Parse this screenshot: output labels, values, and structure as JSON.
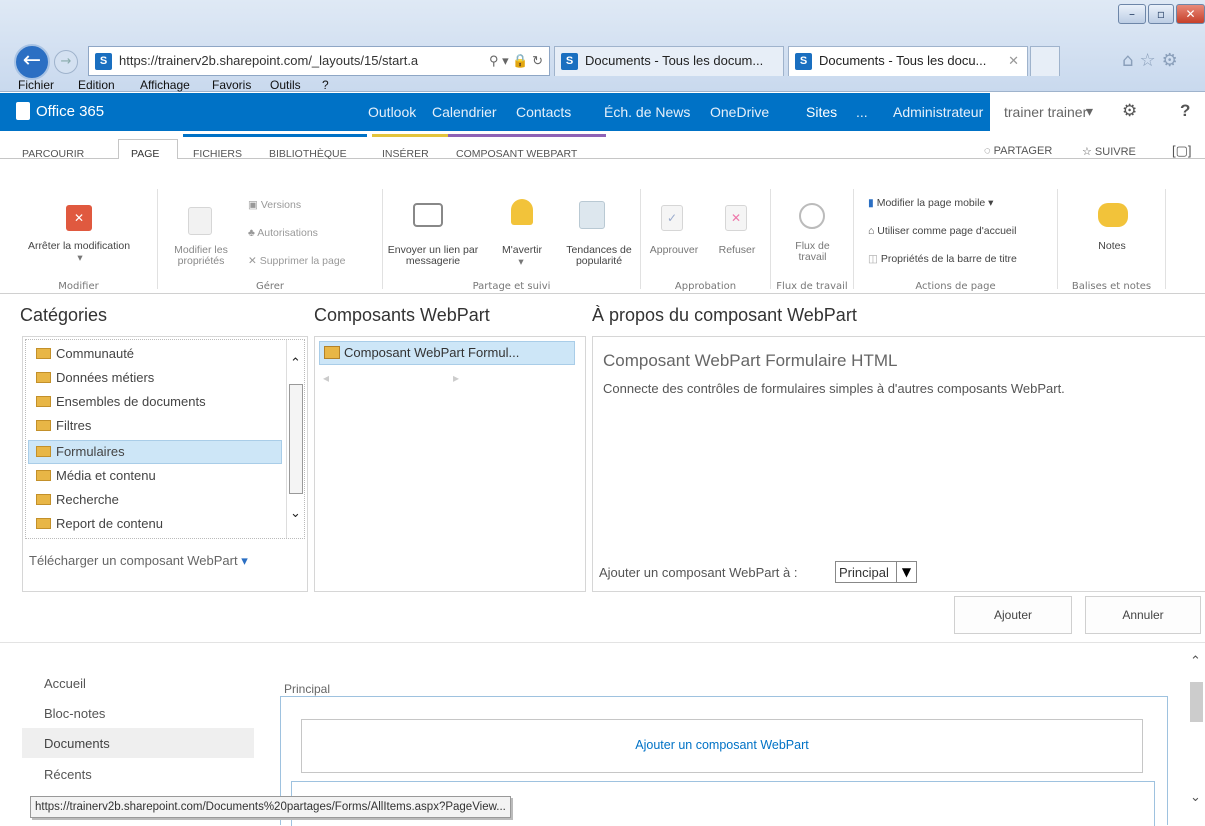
{
  "browser": {
    "window_buttons": {
      "minimize": "–",
      "maximize": "▫",
      "close": "✕"
    },
    "address": "https://trainerv2b.sharepoint.com/_layouts/15/start.a",
    "tabs": [
      "Documents - Tous les docum...",
      "Documents - Tous les docu..."
    ],
    "menu": [
      "Fichier",
      "Edition",
      "Affichage",
      "Favoris",
      "Outils",
      "?"
    ],
    "status_url": "https://trainerv2b.sharepoint.com/Documents%20partages/Forms/AllItems.aspx?PageView..."
  },
  "o365": {
    "logo": "Office 365",
    "nav": [
      "Outlook",
      "Calendrier",
      "Contacts",
      "Éch. de News",
      "OneDrive",
      "Sites",
      "...",
      "Administrateur"
    ],
    "user": "trainer trainer",
    "accent": "#0072c6"
  },
  "ribbon": {
    "tabs": [
      "PARCOURIR",
      "PAGE",
      "FICHIERS",
      "BIBLIOTHÈQUE",
      "INSÉRER",
      "COMPOSANT WEBPART"
    ],
    "share": "PARTAGER",
    "follow": "SUIVRE",
    "groups": {
      "modifier": {
        "label": "Modifier",
        "stop": "Arrêter la modification"
      },
      "gerer": {
        "label": "Gérer",
        "props": [
          "Modifier les",
          "propriétés"
        ],
        "versions": "Versions",
        "auth": "Autorisations",
        "delete": "Supprimer la page"
      },
      "partage": {
        "label": "Partage et suivi",
        "email": [
          "Envoyer un lien par",
          "messagerie"
        ],
        "alert": "M'avertir",
        "trends": [
          "Tendances de",
          "popularité"
        ]
      },
      "approbation": {
        "label": "Approbation",
        "approve": "Approuver",
        "reject": "Refuser"
      },
      "flux": {
        "label": "Flux de travail",
        "wf": [
          "Flux de",
          "travail"
        ]
      },
      "actions": {
        "label": "Actions de page",
        "mobile": "Modifier la page mobile",
        "home": "Utiliser comme page d'accueil",
        "titlebar": "Propriétés de la barre de titre"
      },
      "balises": {
        "label": "Balises et notes",
        "notes": "Notes"
      }
    }
  },
  "picker": {
    "categories_title": "Catégories",
    "webparts_title": "Composants WebPart",
    "about_title": "À propos du composant WebPart",
    "categories": [
      "Communauté",
      "Données métiers",
      "Ensembles de documents",
      "Filtres",
      "Formulaires",
      "Média et contenu",
      "Recherche",
      "Report de contenu"
    ],
    "upload": "Télécharger un composant WebPart",
    "webpart_item": "Composant WebPart Formul...",
    "about_name": "Composant WebPart Formulaire HTML",
    "about_desc": "Connecte des contrôles de formulaires simples à d'autres composants WebPart.",
    "add_to_label": "Ajouter un composant WebPart à :",
    "zone": "Principal",
    "add_button": "Ajouter",
    "cancel_button": "Annuler"
  },
  "page": {
    "left_nav": [
      "Accueil",
      "Bloc-notes",
      "Documents",
      "Récents"
    ],
    "zone_label": "Principal",
    "add_webpart": "Ajouter un composant WebPart"
  }
}
